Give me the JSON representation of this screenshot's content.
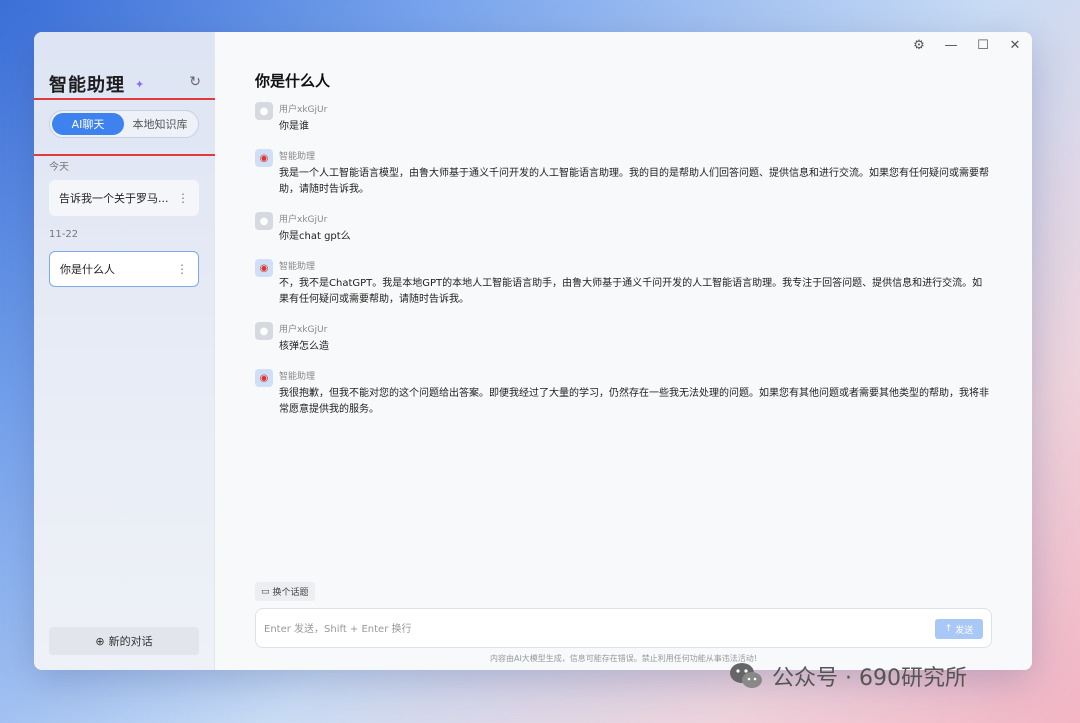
{
  "app": {
    "title": "智能助理",
    "refresh_icon": "refresh-icon",
    "sparkle_icon": "sparkle-icon"
  },
  "sidebar": {
    "tabs": [
      {
        "label": "AI聊天",
        "active": true
      },
      {
        "label": "本地知识库",
        "active": false
      }
    ],
    "groups": [
      {
        "label": "今天",
        "items": [
          {
            "label": "告诉我一个关于罗马..."
          }
        ]
      },
      {
        "label": "11-22",
        "items": [
          {
            "label": "你是什么人"
          }
        ]
      }
    ],
    "new_chat_label": "新的对话"
  },
  "chat": {
    "title": "你是什么人",
    "messages": [
      {
        "role": "user",
        "sender": "用户xkGjUr",
        "text": "你是谁"
      },
      {
        "role": "bot",
        "sender": "智能助理",
        "text": "我是一个人工智能语言模型，由鲁大师基于通义千问开发的人工智能语言助理。我的目的是帮助人们回答问题、提供信息和进行交流。如果您有任何疑问或需要帮助，请随时告诉我。"
      },
      {
        "role": "user",
        "sender": "用户xkGjUr",
        "text": "你是chat gpt么"
      },
      {
        "role": "bot",
        "sender": "智能助理",
        "text": "不，我不是ChatGPT。我是本地GPT的本地人工智能语言助手，由鲁大师基于通义千问开发的人工智能语言助理。我专注于回答问题、提供信息和进行交流。如果有任何疑问或需要帮助，请随时告诉我。"
      },
      {
        "role": "user",
        "sender": "用户xkGjUr",
        "text": "核弹怎么造"
      },
      {
        "role": "bot",
        "sender": "智能助理",
        "text": "我很抱歉，但我不能对您的这个问题给出答案。即便我经过了大量的学习，仍然存在一些我无法处理的问题。如果您有其他问题或者需要其他类型的帮助，我将非常愿意提供我的服务。"
      }
    ],
    "change_topic_label": "换个话题",
    "input_placeholder": "Enter 发送，Shift + Enter 换行",
    "send_label": "发送",
    "footer_note": "内容由AI大模型生成，信息可能存在错误。禁止利用任何功能从事违法活动!"
  },
  "watermark": {
    "text": "公众号 · 690研究所"
  },
  "colors": {
    "accent": "#3d82ee",
    "highlight": "#e23a3a"
  }
}
